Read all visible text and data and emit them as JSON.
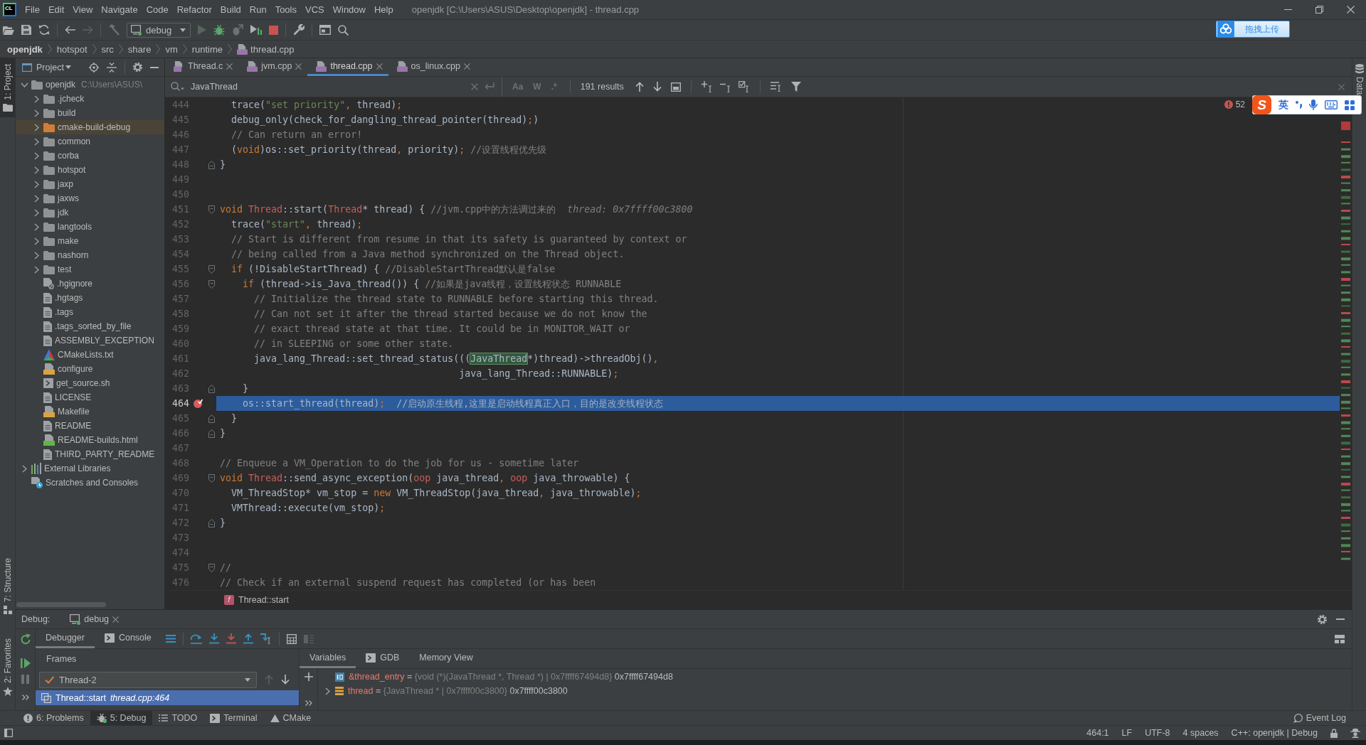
{
  "window": {
    "logo": "CL",
    "menu": [
      "File",
      "Edit",
      "View",
      "Navigate",
      "Code",
      "Refactor",
      "Build",
      "Run",
      "Tools",
      "VCS",
      "Window",
      "Help"
    ],
    "title": "openjdk [C:\\Users\\ASUS\\Desktop\\openjdk] - thread.cpp"
  },
  "toolbar": {
    "run_configuration": "debug"
  },
  "upload_widget": {
    "label": "拖拽上传"
  },
  "navigation_bar": [
    {
      "label": "openjdk",
      "kind": "project"
    },
    {
      "label": "hotspot",
      "kind": "folder"
    },
    {
      "label": "src",
      "kind": "folder"
    },
    {
      "label": "share",
      "kind": "folder"
    },
    {
      "label": "vm",
      "kind": "folder"
    },
    {
      "label": "runtime",
      "kind": "folder"
    },
    {
      "label": "thread.cpp",
      "kind": "file"
    }
  ],
  "left_tool_strip": [
    {
      "label": "1: Project",
      "kind": "project",
      "selected": true
    },
    {
      "label": "7: Structure",
      "kind": "structure",
      "selected": false
    },
    {
      "label": "2: Favorites",
      "kind": "favorites",
      "selected": false
    }
  ],
  "project_panel": {
    "title": "Project",
    "tree": [
      {
        "name": "openjdk",
        "path": "C:\\Users\\ASUS\\",
        "kind": "folder",
        "expanded": true,
        "selected": false,
        "children": [
          {
            "name": ".jcheck",
            "kind": "folder",
            "expanded": false,
            "selected": false
          },
          {
            "name": "build",
            "kind": "folder",
            "expanded": false,
            "selected": false
          },
          {
            "name": "cmake-build-debug",
            "kind": "excluded-folder",
            "expanded": false,
            "selected": true
          },
          {
            "name": "common",
            "kind": "folder",
            "expanded": false,
            "selected": false
          },
          {
            "name": "corba",
            "kind": "folder",
            "expanded": false,
            "selected": false
          },
          {
            "name": "hotspot",
            "kind": "folder",
            "expanded": false,
            "selected": false
          },
          {
            "name": "jaxp",
            "kind": "folder",
            "expanded": false,
            "selected": false
          },
          {
            "name": "jaxws",
            "kind": "folder",
            "expanded": false,
            "selected": false
          },
          {
            "name": "jdk",
            "kind": "folder",
            "expanded": false,
            "selected": false
          },
          {
            "name": "langtools",
            "kind": "folder",
            "expanded": false,
            "selected": false
          },
          {
            "name": "make",
            "kind": "folder",
            "expanded": false,
            "selected": false
          },
          {
            "name": "nashorn",
            "kind": "folder",
            "expanded": false,
            "selected": false
          },
          {
            "name": "test",
            "kind": "folder",
            "expanded": false,
            "selected": false
          },
          {
            "name": ".hgignore",
            "kind": "ignored-file",
            "selected": false
          },
          {
            "name": ".hgtags",
            "kind": "text-file",
            "selected": false
          },
          {
            "name": ".tags",
            "kind": "text-file",
            "selected": false
          },
          {
            "name": ".tags_sorted_by_file",
            "kind": "text-file",
            "selected": false
          },
          {
            "name": "ASSEMBLY_EXCEPTION",
            "kind": "text-file",
            "selected": false
          },
          {
            "name": "CMakeLists.txt",
            "kind": "cmake-file",
            "selected": false
          },
          {
            "name": "configure",
            "kind": "script-file",
            "selected": false
          },
          {
            "name": "get_source.sh",
            "kind": "shell-file",
            "selected": false
          },
          {
            "name": "LICENSE",
            "kind": "text-file",
            "selected": false
          },
          {
            "name": "Makefile",
            "kind": "script-file",
            "selected": false
          },
          {
            "name": "README",
            "kind": "text-file",
            "selected": false
          },
          {
            "name": "README-builds.html",
            "kind": "html-file",
            "selected": false
          },
          {
            "name": "THIRD_PARTY_README",
            "kind": "text-file",
            "selected": false
          }
        ]
      },
      {
        "name": "External Libraries",
        "kind": "libraries",
        "expanded": false,
        "selected": false
      },
      {
        "name": "Scratches and Consoles",
        "kind": "scratches",
        "selected": false
      }
    ]
  },
  "editor": {
    "tabs": [
      {
        "label": "Thread.c",
        "kind": "c",
        "selected": false
      },
      {
        "label": "jvm.cpp",
        "kind": "cpp",
        "selected": false
      },
      {
        "label": "thread.cpp",
        "kind": "cpp",
        "selected": true
      },
      {
        "label": "os_linux.cpp",
        "kind": "cpp",
        "selected": false
      }
    ],
    "find_bar": {
      "value": "JavaThread",
      "options": [
        {
          "label": "Aa",
          "on": false
        },
        {
          "label": "W",
          "on": false
        },
        {
          "label": ".*",
          "on": false
        }
      ],
      "results": "191 results"
    },
    "problems": "52",
    "lines": [
      {
        "number": "444",
        "current": false,
        "breakpoint": false,
        "tokens": [
          {
            "kind": "plain",
            "text": "  trace("
          },
          {
            "kind": "string",
            "text": "\"set priority\""
          },
          {
            "kind": "punct",
            "text": ","
          },
          {
            "kind": "plain",
            "text": " thread)"
          },
          {
            "kind": "punct",
            "text": ";"
          }
        ]
      },
      {
        "number": "445",
        "current": false,
        "breakpoint": false,
        "tokens": [
          {
            "kind": "plain",
            "text": "  debug_only(check_for_dangling_thread_pointer(thread)"
          },
          {
            "kind": "punct",
            "text": ";"
          },
          {
            "kind": "plain",
            "text": ")"
          }
        ]
      },
      {
        "number": "446",
        "current": false,
        "breakpoint": false,
        "tokens": [
          {
            "kind": "comment",
            "text": "  // Can return an error!"
          }
        ]
      },
      {
        "number": "447",
        "current": false,
        "breakpoint": false,
        "tokens": [
          {
            "kind": "plain",
            "text": "  ("
          },
          {
            "kind": "keyword",
            "text": "void"
          },
          {
            "kind": "plain",
            "text": ")os::set_priority(thread"
          },
          {
            "kind": "punct",
            "text": ","
          },
          {
            "kind": "plain",
            "text": " priority)"
          },
          {
            "kind": "punct",
            "text": ";"
          },
          {
            "kind": "comment",
            "text": " //设置线程优先级"
          }
        ]
      },
      {
        "number": "448",
        "current": false,
        "breakpoint": false,
        "fold_marker": {
          "kind": "end"
        },
        "tokens": [
          {
            "kind": "plain",
            "text": "}"
          }
        ]
      },
      {
        "number": "449",
        "current": false,
        "breakpoint": false
      },
      {
        "number": "450",
        "current": false,
        "breakpoint": false
      },
      {
        "number": "451",
        "current": false,
        "breakpoint": false,
        "fold_marker": {
          "kind": "start"
        },
        "tokens": [
          {
            "kind": "keyword",
            "text": "void "
          },
          {
            "kind": "type",
            "text": "Thread"
          },
          {
            "kind": "plain",
            "text": "::start("
          },
          {
            "kind": "type",
            "text": "Thread"
          },
          {
            "kind": "plain",
            "text": "* thread) { "
          },
          {
            "kind": "comment",
            "text": "//jvm.cpp中的方法调过来的"
          }
        ],
        "inline_value": "thread: 0x7ffff00c3800"
      },
      {
        "number": "452",
        "current": false,
        "breakpoint": false,
        "tokens": [
          {
            "kind": "plain",
            "text": "  trace("
          },
          {
            "kind": "string",
            "text": "\"start\""
          },
          {
            "kind": "punct",
            "text": ","
          },
          {
            "kind": "plain",
            "text": " thread)"
          },
          {
            "kind": "punct",
            "text": ";"
          }
        ]
      },
      {
        "number": "453",
        "current": false,
        "breakpoint": false,
        "tokens": [
          {
            "kind": "comment",
            "text": "  // Start is different from resume in that its safety is guaranteed by context or"
          }
        ]
      },
      {
        "number": "454",
        "current": false,
        "breakpoint": false,
        "tokens": [
          {
            "kind": "comment",
            "text": "  // being called from a Java method synchronized on the Thread object."
          }
        ]
      },
      {
        "number": "455",
        "current": false,
        "breakpoint": false,
        "fold_marker": {
          "kind": "start"
        },
        "tokens": [
          {
            "kind": "keyword",
            "text": "  if"
          },
          {
            "kind": "plain",
            "text": " (!DisableStartThread) { "
          },
          {
            "kind": "comment",
            "text": "//DisableStartThread默认是false"
          }
        ]
      },
      {
        "number": "456",
        "current": false,
        "breakpoint": false,
        "fold_marker": {
          "kind": "start"
        },
        "tokens": [
          {
            "kind": "keyword",
            "text": "    if"
          },
          {
            "kind": "plain",
            "text": " (thread->is_Java_thread()) { "
          },
          {
            "kind": "comment",
            "text": "//如果是java线程，设置线程状态 RUNNABLE"
          }
        ]
      },
      {
        "number": "457",
        "current": false,
        "breakpoint": false,
        "tokens": [
          {
            "kind": "comment",
            "text": "      // Initialize the thread state to RUNNABLE before starting this thread."
          }
        ]
      },
      {
        "number": "458",
        "current": false,
        "breakpoint": false,
        "tokens": [
          {
            "kind": "comment",
            "text": "      // Can not set it after the thread started because we do not know the"
          }
        ]
      },
      {
        "number": "459",
        "current": false,
        "breakpoint": false,
        "tokens": [
          {
            "kind": "comment",
            "text": "      // exact thread state at that time. It could be in MONITOR_WAIT or"
          }
        ]
      },
      {
        "number": "460",
        "current": false,
        "breakpoint": false,
        "tokens": [
          {
            "kind": "comment",
            "text": "      // in SLEEPING or some other state."
          }
        ]
      },
      {
        "number": "461",
        "current": false,
        "breakpoint": false,
        "tokens": [
          {
            "kind": "plain",
            "text": "      java_lang_Thread::set_thread_status((("
          },
          {
            "kind": "match",
            "text": "JavaThread"
          },
          {
            "kind": "plain",
            "text": "*)thread)->threadObj()"
          },
          {
            "kind": "punct",
            "text": ","
          }
        ]
      },
      {
        "number": "462",
        "current": false,
        "breakpoint": false,
        "tokens": [
          {
            "kind": "plain",
            "text": "                                          java_lang_Thread::RUNNABLE)"
          },
          {
            "kind": "punct",
            "text": ";"
          }
        ]
      },
      {
        "number": "463",
        "current": false,
        "breakpoint": false,
        "fold_marker": {
          "kind": "end"
        },
        "tokens": [
          {
            "kind": "plain",
            "text": "    }"
          }
        ]
      },
      {
        "number": "464",
        "current": true,
        "breakpoint": true,
        "tokens": [
          {
            "kind": "plain",
            "text": "    os::start_thread(thread)"
          },
          {
            "kind": "punct",
            "text": ";"
          },
          {
            "kind": "comment",
            "text": "  //启动原生线程,这里是启动线程真正入口，目的是改变线程状态"
          }
        ]
      },
      {
        "number": "465",
        "current": false,
        "breakpoint": false,
        "fold_marker": {
          "kind": "end"
        },
        "tokens": [
          {
            "kind": "plain",
            "text": "  }"
          }
        ]
      },
      {
        "number": "466",
        "current": false,
        "breakpoint": false,
        "fold_marker": {
          "kind": "end"
        },
        "tokens": [
          {
            "kind": "plain",
            "text": "}"
          }
        ]
      },
      {
        "number": "467",
        "current": false,
        "breakpoint": false
      },
      {
        "number": "468",
        "current": false,
        "breakpoint": false,
        "tokens": [
          {
            "kind": "comment",
            "text": "// Enqueue a VM_Operation to do the job for us - sometime later"
          }
        ]
      },
      {
        "number": "469",
        "current": false,
        "breakpoint": false,
        "fold_marker": {
          "kind": "start"
        },
        "tokens": [
          {
            "kind": "keyword",
            "text": "void "
          },
          {
            "kind": "type",
            "text": "Thread"
          },
          {
            "kind": "plain",
            "text": "::send_async_exception("
          },
          {
            "kind": "type",
            "text": "oop"
          },
          {
            "kind": "plain",
            "text": " java_thread"
          },
          {
            "kind": "punct",
            "text": ", "
          },
          {
            "kind": "type",
            "text": "oop"
          },
          {
            "kind": "plain",
            "text": " java_throwable) {"
          }
        ]
      },
      {
        "number": "470",
        "current": false,
        "breakpoint": false,
        "tokens": [
          {
            "kind": "plain",
            "text": "  VM_ThreadStop* vm_stop = "
          },
          {
            "kind": "keyword",
            "text": "new"
          },
          {
            "kind": "plain",
            "text": " VM_ThreadStop(java_thread"
          },
          {
            "kind": "punct",
            "text": ","
          },
          {
            "kind": "plain",
            "text": " java_throwable)"
          },
          {
            "kind": "punct",
            "text": ";"
          }
        ]
      },
      {
        "number": "471",
        "current": false,
        "breakpoint": false,
        "tokens": [
          {
            "kind": "plain",
            "text": "  VMThread::execute(vm_stop)"
          },
          {
            "kind": "punct",
            "text": ";"
          }
        ]
      },
      {
        "number": "472",
        "current": false,
        "breakpoint": false,
        "fold_marker": {
          "kind": "end"
        },
        "tokens": [
          {
            "kind": "plain",
            "text": "}"
          }
        ]
      },
      {
        "number": "473",
        "current": false,
        "breakpoint": false
      },
      {
        "number": "474",
        "current": false,
        "breakpoint": false
      },
      {
        "number": "475",
        "current": false,
        "breakpoint": false,
        "fold_marker": {
          "kind": "start"
        },
        "tokens": [
          {
            "kind": "comment",
            "text": "//"
          }
        ]
      },
      {
        "number": "476",
        "current": false,
        "breakpoint": false,
        "tokens": [
          {
            "kind": "comment",
            "text": "// Check if an external suspend request has completed (or has been"
          }
        ]
      }
    ],
    "context": {
      "badge": "f",
      "label": "Thread::start"
    }
  },
  "right_tool_strip": {
    "label": "Data"
  },
  "input_method_bar": {
    "logo": "S",
    "mode": "英"
  },
  "debug_panel": {
    "label": "Debug:",
    "session_tab": "debug",
    "tabs": [
      {
        "label": "Debugger",
        "kind": "debugger",
        "selected": true
      },
      {
        "label": "Console",
        "kind": "console",
        "selected": false
      }
    ],
    "frames": {
      "title": "Frames",
      "thread": "Thread-2",
      "items": [
        {
          "function": "Thread::start",
          "location": "thread.cpp:464",
          "selected": true
        }
      ]
    },
    "variables": {
      "tabs": [
        {
          "label": "Variables",
          "kind": "variables",
          "selected": true
        },
        {
          "label": "GDB",
          "kind": "gdb",
          "selected": false
        },
        {
          "label": "Memory View",
          "kind": "memory",
          "selected": false
        }
      ],
      "items": [
        {
          "name": "&thread_entry",
          "operator": "=",
          "type_info": "{void (*)(JavaThread *, Thread *) | 0x7ffff67494d8}",
          "value": "0x7ffff67494d8",
          "kind": "pointer"
        },
        {
          "name": "thread",
          "operator": "=",
          "type_info": "{JavaThread * | 0x7ffff00c3800}",
          "value": "0x7ffff00c3800",
          "kind": "object",
          "expanded": false
        }
      ]
    }
  },
  "tool_window_bar": {
    "items": [
      {
        "label": "6: Problems",
        "kind": "problems",
        "selected": false
      },
      {
        "label": "5: Debug",
        "kind": "debug",
        "selected": true
      },
      {
        "label": "TODO",
        "kind": "todo",
        "selected": false
      },
      {
        "label": "Terminal",
        "kind": "terminal",
        "selected": false
      },
      {
        "label": "CMake",
        "kind": "cmake",
        "selected": false
      }
    ],
    "event_log": "Event Log"
  },
  "status_bar": {
    "items": [
      "464:1",
      "LF",
      "UTF-8",
      "4 spaces",
      "C++: openjdk | Debug"
    ]
  }
}
